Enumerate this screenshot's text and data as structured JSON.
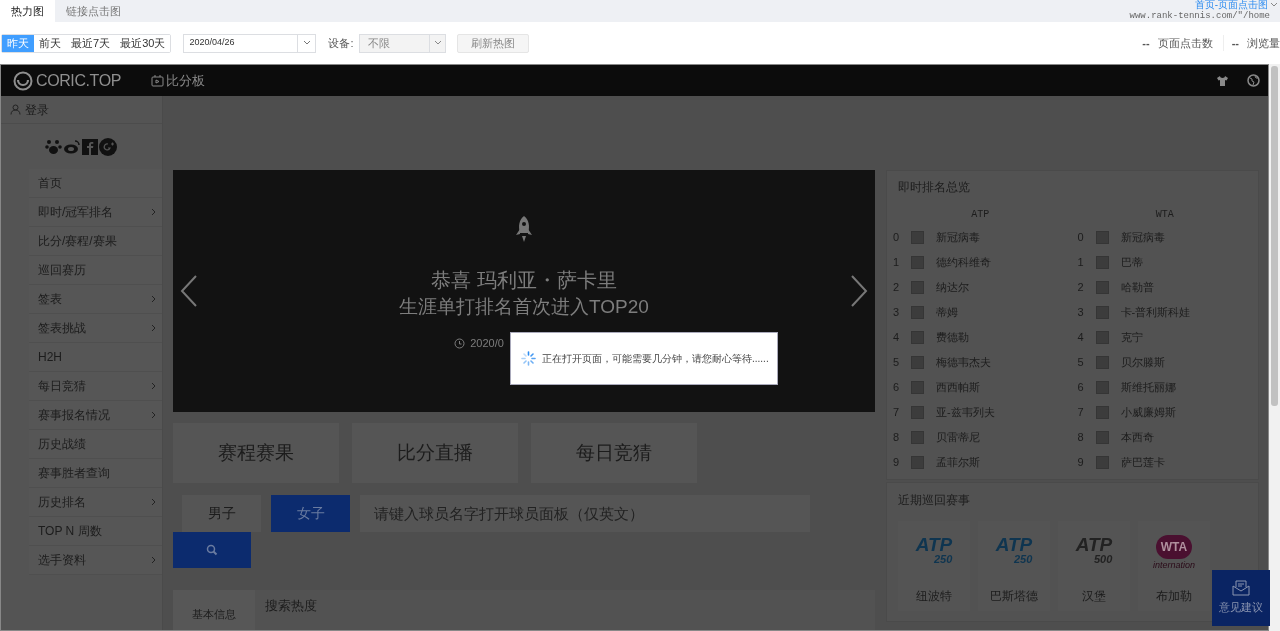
{
  "tabs": [
    {
      "label": "热力图",
      "selected": true
    },
    {
      "label": "链接点击图",
      "selected": false
    }
  ],
  "page_selector": {
    "title": "首页-页面点击图",
    "url": "www.rank-tennis.com/\"/home"
  },
  "date_range_buttons": [
    {
      "label": "昨天",
      "selected": true
    },
    {
      "label": "前天",
      "selected": false
    },
    {
      "label": "最近7天",
      "selected": false
    },
    {
      "label": "最近30天",
      "selected": false
    }
  ],
  "date_field": {
    "value": "2020/04/26"
  },
  "device": {
    "label": "设备:",
    "value": "不限",
    "disabled": true
  },
  "refresh_button": {
    "label": "刷新热图",
    "disabled": true
  },
  "stats": [
    {
      "value": "--",
      "label": "页面点击数"
    },
    {
      "value": "--",
      "label": "浏览量"
    }
  ],
  "site": {
    "logo": "CORIC.TOP",
    "nav": "比分板",
    "login": "登录",
    "menu": [
      {
        "label": "首页",
        "has_submenu": false
      },
      {
        "label": "即时/冠军排名",
        "has_submenu": true
      },
      {
        "label": "比分/赛程/赛果",
        "has_submenu": false
      },
      {
        "label": "巡回赛历",
        "has_submenu": false
      },
      {
        "label": "签表",
        "has_submenu": true
      },
      {
        "label": "签表挑战",
        "has_submenu": true
      },
      {
        "label": "H2H",
        "has_submenu": false
      },
      {
        "label": "每日竞猜",
        "has_submenu": true
      },
      {
        "label": "赛事报名情况",
        "has_submenu": true
      },
      {
        "label": "历史战绩",
        "has_submenu": false
      },
      {
        "label": "赛事胜者查询",
        "has_submenu": false
      },
      {
        "label": "历史排名",
        "has_submenu": true
      },
      {
        "label": "TOP N 周数",
        "has_submenu": false
      },
      {
        "label": "选手资料",
        "has_submenu": true
      }
    ],
    "banner": {
      "title": "恭喜 玛利亚・萨卡里",
      "subtitle": "生涯单打排名首次进入TOP20",
      "date": "2020/0"
    },
    "quick_links": [
      "赛程赛果",
      "比分直播",
      "每日竞猜"
    ],
    "gender_tabs": [
      {
        "label": "男子",
        "selected": false
      },
      {
        "label": "女子",
        "selected": true
      }
    ],
    "search": {
      "placeholder": "请键入球员名字打开球员面板（仅英文）"
    },
    "info_tabs": [
      "基本信息"
    ],
    "info_title": "搜索热度",
    "rankings": {
      "title": "即时排名总览",
      "columns": [
        {
          "heading": "ATP",
          "rows": [
            {
              "rank": "0",
              "name": "新冠病毒"
            },
            {
              "rank": "1",
              "name": "德约科维奇"
            },
            {
              "rank": "2",
              "name": "纳达尔"
            },
            {
              "rank": "3",
              "name": "蒂姆"
            },
            {
              "rank": "4",
              "name": "费德勒"
            },
            {
              "rank": "5",
              "name": "梅德韦杰夫"
            },
            {
              "rank": "6",
              "name": "西西帕斯"
            },
            {
              "rank": "7",
              "name": "亚-兹韦列夫"
            },
            {
              "rank": "8",
              "name": "贝雷蒂尼"
            },
            {
              "rank": "9",
              "name": "孟菲尔斯"
            }
          ]
        },
        {
          "heading": "WTA",
          "rows": [
            {
              "rank": "0",
              "name": "新冠病毒"
            },
            {
              "rank": "1",
              "name": "巴蒂"
            },
            {
              "rank": "2",
              "name": "哈勒普"
            },
            {
              "rank": "3",
              "name": "卡-普利斯科娃"
            },
            {
              "rank": "4",
              "name": "克宁"
            },
            {
              "rank": "5",
              "name": "贝尔滕斯"
            },
            {
              "rank": "6",
              "name": "斯维托丽娜"
            },
            {
              "rank": "7",
              "name": "小威廉姆斯"
            },
            {
              "rank": "8",
              "name": "本西奇"
            },
            {
              "rank": "9",
              "name": "萨巴莲卡"
            }
          ]
        }
      ]
    },
    "tournaments": {
      "title": "近期巡回赛事",
      "items": [
        {
          "kind": "atp",
          "logo": "ATP",
          "tier": "250",
          "name": "纽波特"
        },
        {
          "kind": "atp",
          "logo": "ATP",
          "tier": "250",
          "name": "巴斯塔德"
        },
        {
          "kind": "atp_grey",
          "logo": "ATP",
          "tier": "500",
          "name": "汉堡"
        },
        {
          "kind": "wta",
          "logo": "WTA",
          "tier": "internation",
          "name": "布加勒"
        }
      ]
    },
    "feedback": "意见建议"
  },
  "loading_dialog": {
    "message": "正在打开页面，可能需要几分钟，请您耐心等待......"
  }
}
